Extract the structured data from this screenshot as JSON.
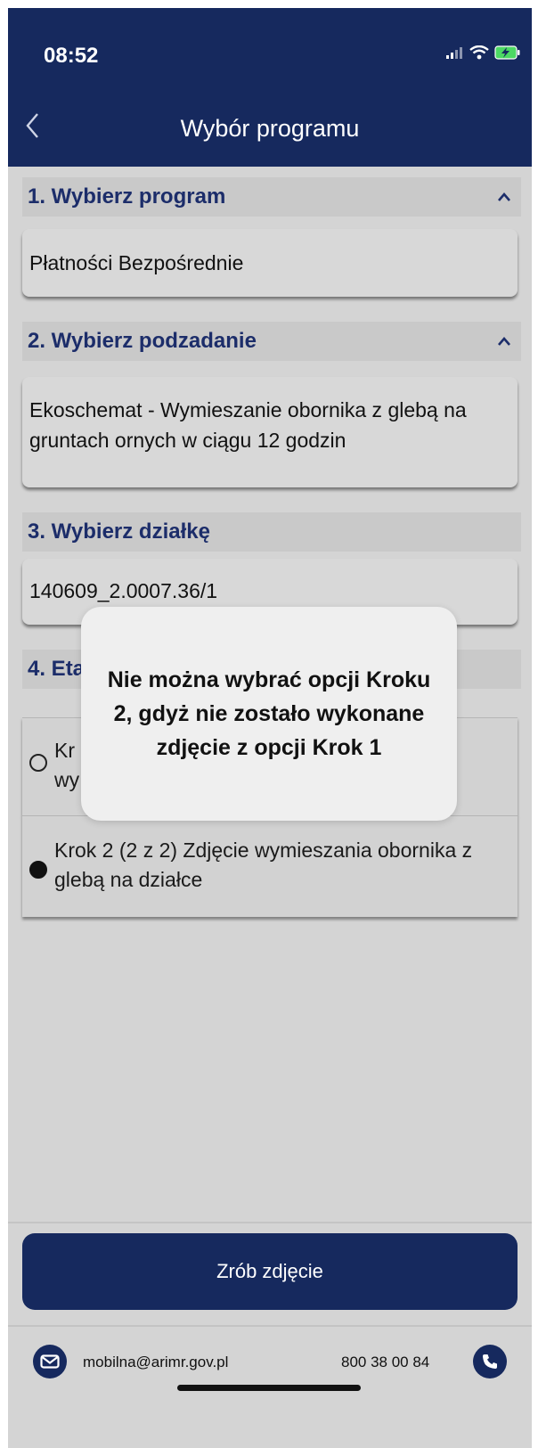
{
  "status_bar": {
    "time": "08:52",
    "icons": [
      "signal-icon",
      "wifi-icon",
      "battery-charging-icon"
    ]
  },
  "nav": {
    "title": "Wybór programu",
    "back_icon": "chevron-left-icon"
  },
  "sections": {
    "program": {
      "header": "1. Wybierz program",
      "value": "Płatności Bezpośrednie",
      "expanded": true
    },
    "subtask": {
      "header": "2. Wybierz podzadanie",
      "value": "Ekoschemat - Wymieszanie obornika z glebą na gruntach ornych w ciągu 12 godzin",
      "expanded": true
    },
    "parcel": {
      "header": "3. Wybierz działkę",
      "value": "140609_2.0007.36/1"
    },
    "stage": {
      "header_visible": "4. Eta",
      "options": [
        {
          "label_visible_line1": "Kr",
          "label_visible_line2": "wy",
          "selected": false
        },
        {
          "label": "Krok 2 (2 z 2) Zdjęcie wymieszania obornika z glebą na działce",
          "selected": true
        }
      ]
    }
  },
  "toast": {
    "message": "Nie można wybrać opcji Kroku 2, gdyż nie zostało wykonane zdjęcie z opcji Krok 1"
  },
  "actions": {
    "take_photo_label": "Zrób zdjęcie"
  },
  "footer": {
    "email": "mobilna@arimr.gov.pl",
    "phone": "800 38 00 84"
  },
  "colors": {
    "primary": "#16295e",
    "section_title": "#1c2d6a",
    "background": "#d4d4d4"
  }
}
